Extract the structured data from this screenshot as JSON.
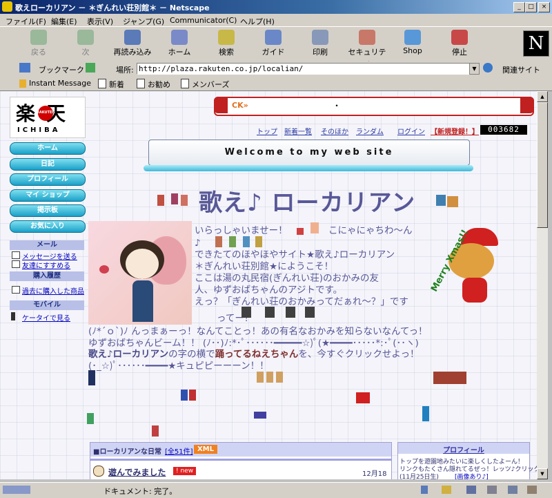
{
  "window": {
    "title": "歌えローカリアン － ＊ぎんれい荘別館＊ － Netscape",
    "btn_min": "_",
    "btn_max": "□",
    "btn_close": "×"
  },
  "menu": [
    "ファイル(F)",
    "編集(E)",
    "表示(V)",
    "ジャンプ(G)",
    "Communicator(C)",
    "ヘルプ(H)"
  ],
  "toolbar": {
    "back": "戻る",
    "forward": "次",
    "reload": "再読み込み",
    "home": "ホーム",
    "search": "検索",
    "guide": "ガイド",
    "print": "印刷",
    "security": "セキュリティ",
    "shop": "Shop",
    "stop": "停止",
    "logo": "N"
  },
  "location": {
    "bookmarks": "ブックマーク",
    "label": "場所:",
    "url": "http://plaza.rakuten.co.jp/localian/",
    "related": "関連サイト"
  },
  "personal": {
    "im": "Instant Message",
    "new": "新着",
    "recommend": "お勧め",
    "members": "メンバーズ"
  },
  "rakuten": {
    "kanji": "楽天",
    "small": "RAKUTEN",
    "ichiba": "ICHIBA"
  },
  "ticker": {
    "prefix": "CK»",
    "dot": "・"
  },
  "toplinks": [
    "トップ",
    "新着一覧",
    "そのほか",
    "ランダム",
    "ログイン",
    "【新規登録！】"
  ],
  "counter": "003682",
  "welcome": "Welcome to my web site",
  "nav": [
    "ホーム",
    "日記",
    "プロフィール",
    "マイ ショップ",
    "掲示板",
    "お気に入り"
  ],
  "sidebar": {
    "mail_head": "メール",
    "mail_send": "メッセージを送る",
    "mail_friend": "友達にすすめる",
    "buy_head": "購入履歴",
    "buy_past": "過去に購入した商品",
    "mobile_head": "モバイル",
    "mobile_link": "ケータイで見る"
  },
  "main_title": "歌え♪ ローカリアン",
  "greeting": [
    "いらっしゃいませー！",
    "こにゃにゃちわ～ん",
    "♪",
    "できたてのほやほやサイト★歌え♪ローカリアン",
    "＊ぎんれい荘別館★にようこそ！",
    "ここは湯の丸民宿(ぎんれい荘)のおかみの友",
    "人、ゆずおばちゃんのアジトです。",
    "えっ？「ぎんれい荘のおかみってだぁれ～？」です",
    "ってー？"
  ],
  "body_lines": [
    "(ﾉ*´ｏ`)ﾉ  んっまぁーっ！なんてことっ！あの有名なおかみを知らないなんてっ！",
    "ゆずおばちゃんビーム！！ (ﾉ･･)ﾉ:*･ﾟ･･････━━━━━☆)ﾟ(★━━━━･････*:･ﾟ(･･ヽ)",
    "(･_☆)ﾟ･･････━━━━★キュピピーーーン！！"
  ],
  "call": {
    "pre": "歌え♪ローカリアン",
    "mid": "の字の横で",
    "link": "踊ってるねえちゃん",
    "post": "を、今すぐクリックせよっ！"
  },
  "merry": "Merry Xmas!!",
  "diary": {
    "title": "■ローカリアンな日常",
    "count": "[全51件]",
    "xml": "XML",
    "entry": "遊んでみました",
    "new": "! new",
    "date": "12月18日"
  },
  "profile": {
    "head": "プロフィール",
    "l1": "トップを遊園地みたいに楽しくしたよーん！",
    "l2": "リンクもたくさん隠れてるぜっ！レッツ♪クリック",
    "l3": "(11月25日生)",
    "l4": "[画像あり♪]"
  },
  "status": {
    "text": "ドキュメント: 完了。"
  },
  "colors": {
    "accent": "#585898",
    "nav": "#1aa0c8",
    "titlebar": "#0a246a"
  }
}
